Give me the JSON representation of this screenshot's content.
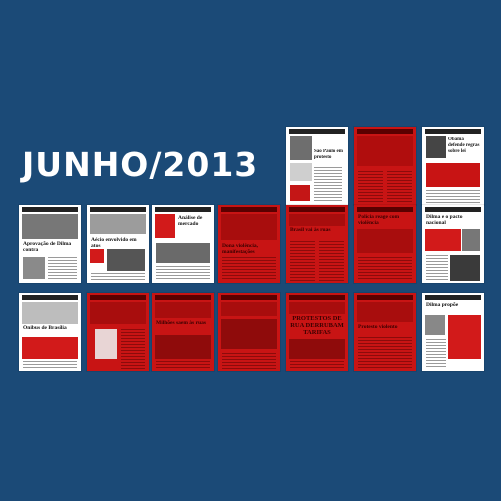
{
  "title": "JUNHO/2013",
  "pages": [
    {
      "headline": "São Paulo em protesto",
      "tone": "mixed"
    },
    {
      "headline": "",
      "tone": "red"
    },
    {
      "headline": "Obama defende regras sobre lei",
      "tone": "mixed"
    },
    {
      "headline": "Aprovação de Dilma contra",
      "tone": "white"
    },
    {
      "headline": "Aécio envolvido em atos",
      "tone": "white"
    },
    {
      "headline": "Análise de mercado",
      "tone": "mixed"
    },
    {
      "headline": "Dona violência, manifestações",
      "tone": "red"
    },
    {
      "headline": "Brasil vai às ruas",
      "tone": "red"
    },
    {
      "headline": "Polícia reage com violência",
      "tone": "red"
    },
    {
      "headline": "Dilma e o pacto nacional",
      "tone": "mixed"
    },
    {
      "headline": "Ônibus de Brasília",
      "tone": "mixed"
    },
    {
      "headline": "",
      "tone": "red"
    },
    {
      "headline": "Milhões saem às ruas",
      "tone": "red"
    },
    {
      "headline": "",
      "tone": "red"
    },
    {
      "headline": "PROTESTOS DE RUA DERRUBAM TARIFAS",
      "tone": "red"
    },
    {
      "headline": "Protesto violento",
      "tone": "red"
    },
    {
      "headline": "Dilma propõe",
      "tone": "mixed"
    }
  ]
}
